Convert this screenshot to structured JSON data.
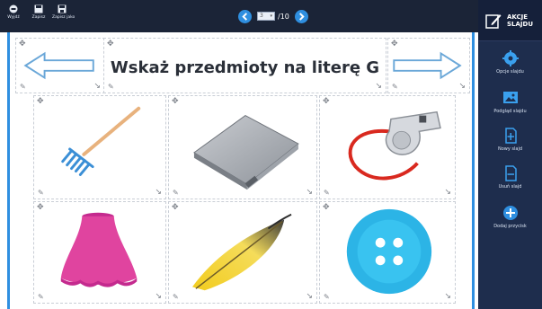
{
  "toolbar": {
    "buttons": [
      {
        "label": "Wyjdź",
        "icon": "exit-icon"
      },
      {
        "label": "Zapisz",
        "icon": "save-icon"
      },
      {
        "label": "Zapisz jako",
        "icon": "save-as-icon"
      }
    ],
    "pager": {
      "current": "3",
      "total": "/10"
    }
  },
  "sidebar": {
    "title": "AKCJE SLAJDU",
    "items": [
      {
        "label": "Opcje slajdu",
        "icon": "gear-icon"
      },
      {
        "label": "Podgląd slajdu",
        "icon": "image-preview-icon"
      },
      {
        "label": "Nowy slajd",
        "icon": "new-slide-icon"
      },
      {
        "label": "Usuń slajd",
        "icon": "delete-slide-icon"
      },
      {
        "label": "Dodaj przycisk",
        "icon": "add-button-icon"
      }
    ]
  },
  "slide": {
    "title": "Wskaż przedmioty na literę G",
    "tiles": [
      {
        "name": "rake-image",
        "icon": "rake"
      },
      {
        "name": "notebook-image",
        "icon": "notebook"
      },
      {
        "name": "whistle-image",
        "icon": "whistle"
      },
      {
        "name": "lampshade-image",
        "icon": "lampshade"
      },
      {
        "name": "feather-image",
        "icon": "feather"
      },
      {
        "name": "button-image",
        "icon": "button"
      }
    ]
  },
  "colors": {
    "topbar": "#1b2437",
    "sidebar": "#1e2d4d",
    "accent": "#2f8fe0"
  }
}
